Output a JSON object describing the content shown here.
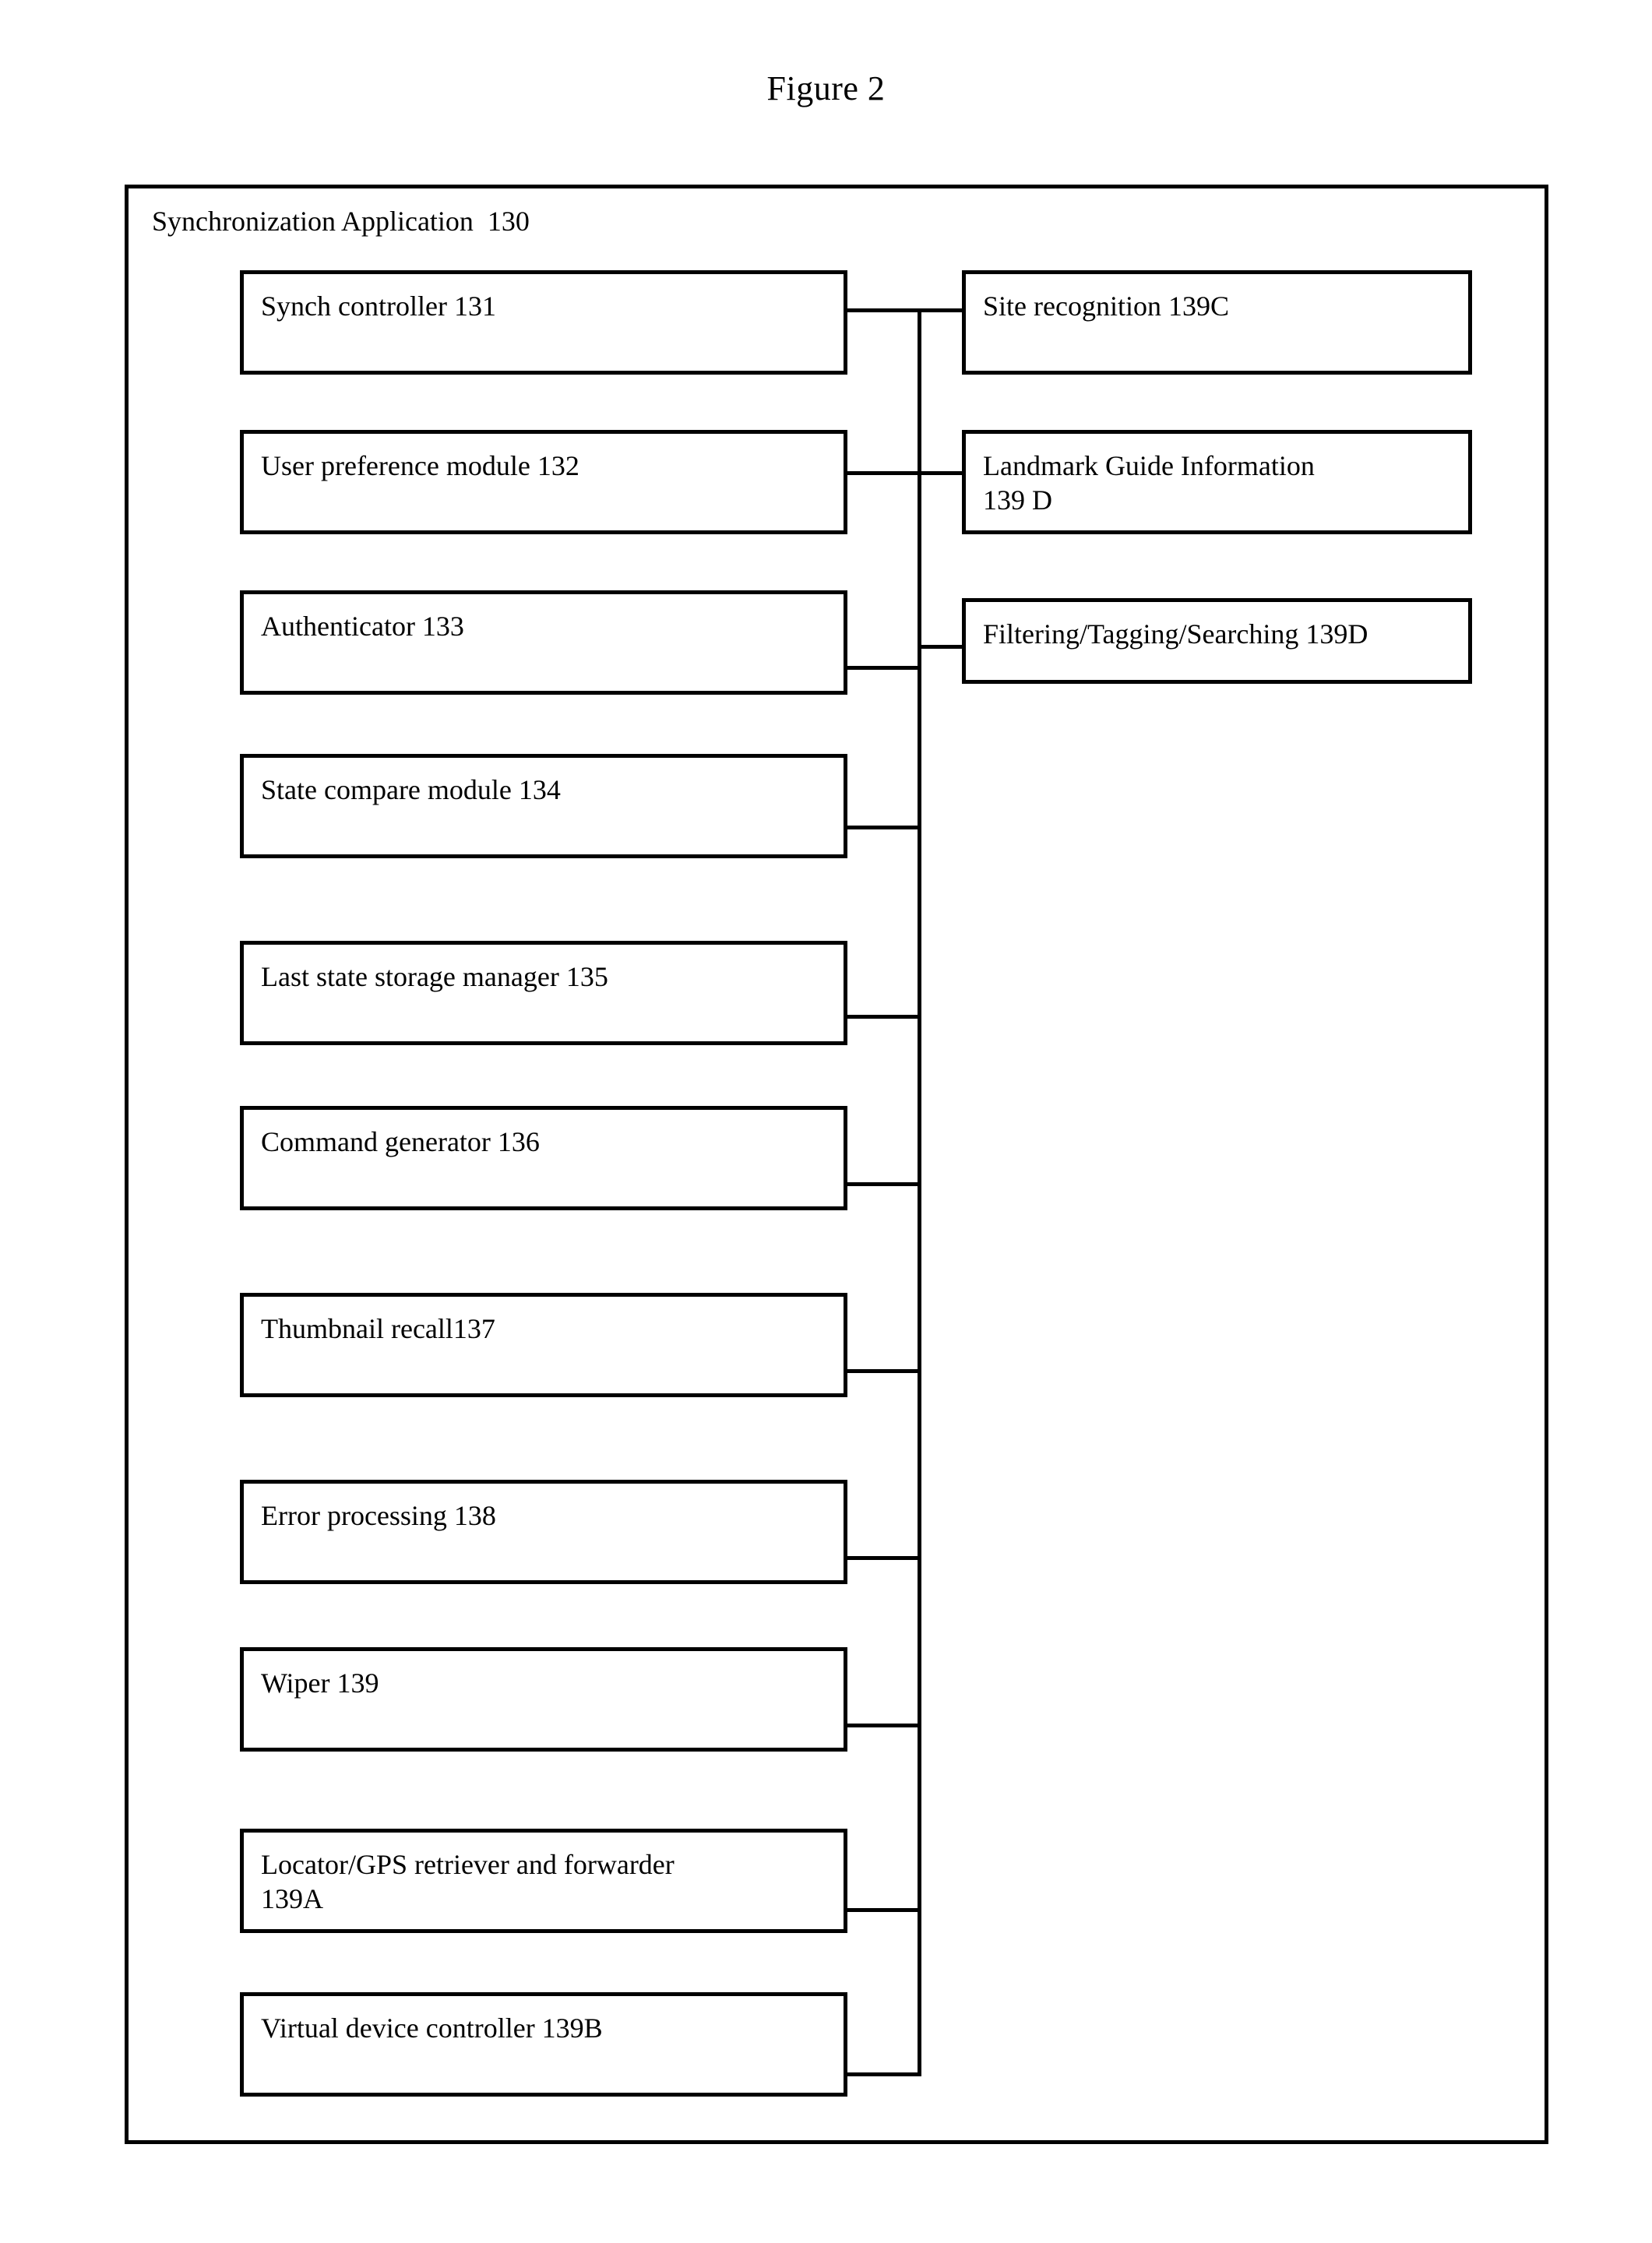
{
  "figure": {
    "title": "Figure 2"
  },
  "container": {
    "label": "Synchronization Application  130"
  },
  "left_modules": [
    {
      "label": "Synch controller 131"
    },
    {
      "label": "User preference module 132"
    },
    {
      "label": "Authenticator 133"
    },
    {
      "label": "State compare module 134"
    },
    {
      "label": "Last state storage manager 135"
    },
    {
      "label": "Command generator 136"
    },
    {
      "label": "Thumbnail recall137"
    },
    {
      "label": "Error processing 138"
    },
    {
      "label": "Wiper 139"
    },
    {
      "label": "Locator/GPS retriever and forwarder\n139A"
    },
    {
      "label": "Virtual device controller 139B"
    }
  ],
  "right_modules": [
    {
      "label": "Site recognition 139C"
    },
    {
      "label": "Landmark Guide Information\n139 D"
    },
    {
      "label": "Filtering/Tagging/Searching 139D"
    }
  ],
  "colors": {
    "stroke": "#000000",
    "background": "#ffffff"
  }
}
